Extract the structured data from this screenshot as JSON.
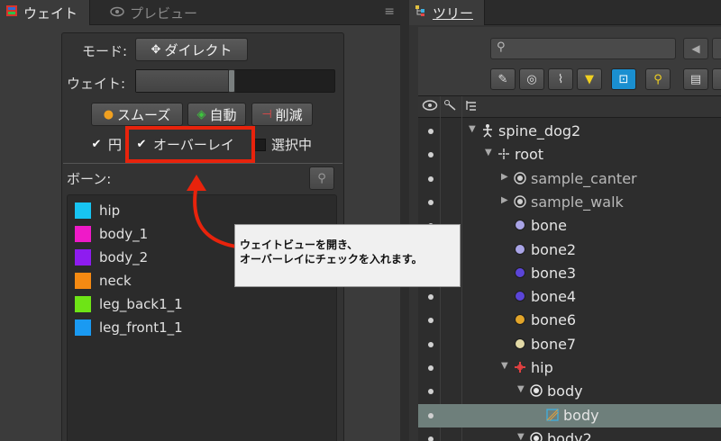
{
  "left_panel": {
    "tab_weights": "ウェイト",
    "tab_preview": "プレビュー",
    "mode_label": "モード:",
    "mode_value": "ダイレクト",
    "weight_label": "ウェイト:",
    "weight_value": 0.48,
    "smooth_label": "スムーズ",
    "auto_label": "自動",
    "prune_label": "削減",
    "circle_label": "円",
    "overlay_label": "オーバーレイ",
    "selected_label": "選択中",
    "bones_label": "ボーン:",
    "bones": [
      {
        "name": "hip",
        "color": "#17c4f2"
      },
      {
        "name": "body_1",
        "color": "#ef1ac8"
      },
      {
        "name": "body_2",
        "color": "#8e1cf0"
      },
      {
        "name": "neck",
        "color": "#f58a12"
      },
      {
        "name": "leg_back1_1",
        "color": "#6ee416"
      },
      {
        "name": "leg_front1_1",
        "color": "#1a9af2"
      }
    ]
  },
  "callout": {
    "line1": "ウェイトビューを開き、",
    "line2": "オーバーレイにチェックを入れます。"
  },
  "tree_panel": {
    "tab_label": "ツリー",
    "accent": "#1a8fd0",
    "highlight_color": "#e8230c",
    "items": [
      {
        "label": "spine_dog2",
        "icon": "skeleton-icon",
        "depth": 0,
        "expand": "▼"
      },
      {
        "label": "root",
        "icon": "bone-root-icon",
        "depth": 1,
        "expand": "▼"
      },
      {
        "label": "sample_canter",
        "icon": "animation-icon",
        "depth": 2,
        "expand": "▶",
        "dim": true
      },
      {
        "label": "sample_walk",
        "icon": "animation-icon",
        "depth": 2,
        "expand": "▶",
        "dim": true
      },
      {
        "label": "bone",
        "icon": "bone-icon",
        "depth": 2,
        "color": "#a9a4e6"
      },
      {
        "label": "bone2",
        "icon": "bone-icon",
        "depth": 2,
        "color": "#a9a4e6"
      },
      {
        "label": "bone3",
        "icon": "bone-icon",
        "depth": 2,
        "color": "#5b45d8"
      },
      {
        "label": "bone4",
        "icon": "bone-icon",
        "depth": 2,
        "color": "#5b45d8"
      },
      {
        "label": "bone6",
        "icon": "bone-icon",
        "depth": 2,
        "color": "#e2a52a"
      },
      {
        "label": "bone7",
        "icon": "bone-icon",
        "depth": 2,
        "color": "#e2d9a6"
      },
      {
        "label": "hip",
        "icon": "hip-bone-icon",
        "depth": 2,
        "expand": "▼"
      },
      {
        "label": "body",
        "icon": "slot-icon",
        "depth": 3,
        "expand": "▼"
      },
      {
        "label": "body",
        "icon": "mesh-icon",
        "depth": 4,
        "selected": true
      },
      {
        "label": "body2",
        "icon": "slot-icon",
        "depth": 3,
        "expand": "▼"
      }
    ]
  }
}
